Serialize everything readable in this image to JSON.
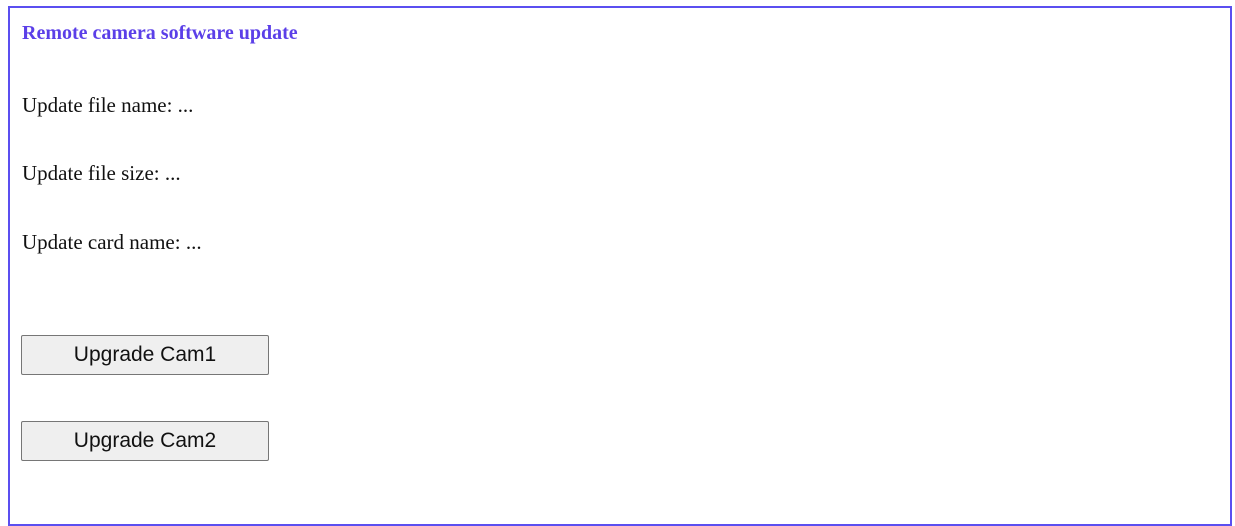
{
  "panel": {
    "title": "Remote camera software update",
    "file_name_line": "Update file name: ...",
    "file_size_line": "Update file size: ...",
    "card_name_line": "Update card name: ...",
    "buttons": [
      {
        "label": "Upgrade Cam1"
      },
      {
        "label": "Upgrade Cam2"
      }
    ]
  },
  "colors": {
    "border": "#5b4ff0",
    "title": "#5b3fe8",
    "button_bg": "#efefef"
  }
}
